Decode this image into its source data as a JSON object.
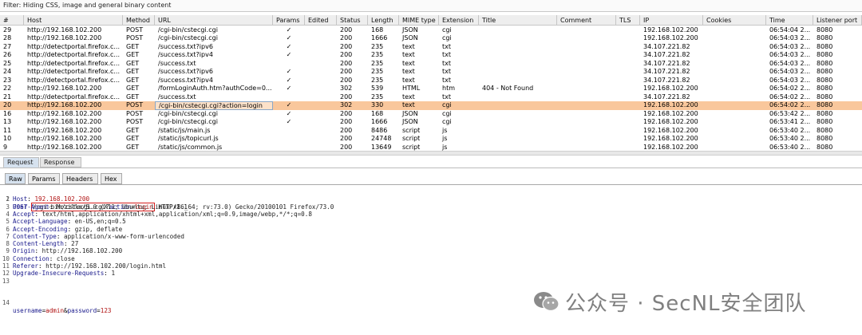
{
  "filter": {
    "text": "Filter: Hiding CSS, image and general binary content"
  },
  "table": {
    "headers": [
      "#",
      "Host",
      "Method",
      "URL",
      "Params",
      "Edited",
      "Status",
      "Length",
      "MIME type",
      "Extension",
      "Title",
      "Comment",
      "TLS",
      "IP",
      "Cookies",
      "Time",
      "Listener port"
    ],
    "rows": [
      [
        "29",
        "http://192.168.102.200",
        "POST",
        "/cgi-bin/cstecgi.cgi",
        "✓",
        "",
        "200",
        "168",
        "JSON",
        "cgi",
        "",
        "",
        "",
        "192.168.102.200",
        "",
        "06:54:04 2...",
        "8080"
      ],
      [
        "28",
        "http://192.168.102.200",
        "POST",
        "/cgi-bin/cstecgi.cgi",
        "✓",
        "",
        "200",
        "1666",
        "JSON",
        "cgi",
        "",
        "",
        "",
        "192.168.102.200",
        "",
        "06:54:03 2...",
        "8080"
      ],
      [
        "27",
        "http://detectportal.firefox.c...",
        "GET",
        "/success.txt?ipv6",
        "✓",
        "",
        "200",
        "235",
        "text",
        "txt",
        "",
        "",
        "",
        "34.107.221.82",
        "",
        "06:54:03 2...",
        "8080"
      ],
      [
        "26",
        "http://detectportal.firefox.c...",
        "GET",
        "/success.txt?ipv4",
        "✓",
        "",
        "200",
        "235",
        "text",
        "txt",
        "",
        "",
        "",
        "34.107.221.82",
        "",
        "06:54:03 2...",
        "8080"
      ],
      [
        "25",
        "http://detectportal.firefox.c...",
        "GET",
        "/success.txt",
        "",
        "",
        "200",
        "235",
        "text",
        "txt",
        "",
        "",
        "",
        "34.107.221.82",
        "",
        "06:54:03 2...",
        "8080"
      ],
      [
        "24",
        "http://detectportal.firefox.c...",
        "GET",
        "/success.txt?ipv6",
        "✓",
        "",
        "200",
        "235",
        "text",
        "txt",
        "",
        "",
        "",
        "34.107.221.82",
        "",
        "06:54:03 2...",
        "8080"
      ],
      [
        "23",
        "http://detectportal.firefox.c...",
        "GET",
        "/success.txt?ipv4",
        "✓",
        "",
        "200",
        "235",
        "text",
        "txt",
        "",
        "",
        "",
        "34.107.221.82",
        "",
        "06:54:03 2...",
        "8080"
      ],
      [
        "22",
        "http://192.168.102.200",
        "GET",
        "/formLoginAuth.htm?authCode=0...",
        "✓",
        "",
        "302",
        "539",
        "HTML",
        "htm",
        "404 - Not Found",
        "",
        "",
        "192.168.102.200",
        "",
        "06:54:02 2...",
        "8080"
      ],
      [
        "21",
        "http://detectportal.firefox.c...",
        "GET",
        "/success.txt",
        "",
        "",
        "200",
        "235",
        "text",
        "txt",
        "",
        "",
        "",
        "34.107.221.82",
        "",
        "06:54:02 2...",
        "8080"
      ],
      [
        "20",
        "http://192.168.102.200",
        "POST",
        "/cgi-bin/cstecgi.cgi?action=login",
        "✓",
        "",
        "302",
        "330",
        "text",
        "cgi",
        "",
        "",
        "",
        "192.168.102.200",
        "",
        "06:54:02 2...",
        "8080"
      ],
      [
        "16",
        "http://192.168.102.200",
        "POST",
        "/cgi-bin/cstecgi.cgi",
        "✓",
        "",
        "200",
        "168",
        "JSON",
        "cgi",
        "",
        "",
        "",
        "192.168.102.200",
        "",
        "06:53:42 2...",
        "8080"
      ],
      [
        "13",
        "http://192.168.102.200",
        "POST",
        "/cgi-bin/cstecgi.cgi",
        "✓",
        "",
        "200",
        "1666",
        "JSON",
        "cgi",
        "",
        "",
        "",
        "192.168.102.200",
        "",
        "06:53:41 2...",
        "8080"
      ],
      [
        "11",
        "http://192.168.102.200",
        "GET",
        "/static/js/main.js",
        "",
        "",
        "200",
        "8486",
        "script",
        "js",
        "",
        "",
        "",
        "192.168.102.200",
        "",
        "06:53:40 2...",
        "8080"
      ],
      [
        "10",
        "http://192.168.102.200",
        "GET",
        "/static/js/topicurl.js",
        "",
        "",
        "200",
        "24748",
        "script",
        "js",
        "",
        "",
        "",
        "192.168.102.200",
        "",
        "06:53:40 2...",
        "8080"
      ],
      [
        "9",
        "http://192.168.102.200",
        "GET",
        "/static/js/common.js",
        "",
        "",
        "200",
        "13649",
        "script",
        "js",
        "",
        "",
        "",
        "192.168.102.200",
        "",
        "06:53:40 2...",
        "8080"
      ]
    ],
    "selected_row": "20"
  },
  "tabs": {
    "request": "Request",
    "response": "Response"
  },
  "subtabs": {
    "raw": "Raw",
    "params": "Params",
    "headers": "Headers",
    "hex": "Hex"
  },
  "request": {
    "line1": {
      "method": "POST ",
      "path": "/cgi-bin/cstecgi.cgi",
      "qmark": "?",
      "qkey": "action",
      "eq": "=",
      "qval": "login",
      "proto": " HTTP/1.1"
    },
    "headers": [
      {
        "n": "2",
        "name": "Host",
        "value": " 192.168.102.200"
      },
      {
        "n": "3",
        "name": "User-Agent",
        "value": " Mozilla/5.0 (X11; Ubuntu; Linux x86_64; rv:73.0) Gecko/20100101 Firefox/73.0"
      },
      {
        "n": "4",
        "name": "Accept",
        "value": " text/html,application/xhtml+xml,application/xml;q=0.9,image/webp,*/*;q=0.8"
      },
      {
        "n": "5",
        "name": "Accept-Language",
        "value": " en-US,en;q=0.5"
      },
      {
        "n": "6",
        "name": "Accept-Encoding",
        "value": " gzip, deflate"
      },
      {
        "n": "7",
        "name": "Content-Type",
        "value": " application/x-www-form-urlencoded"
      },
      {
        "n": "8",
        "name": "Content-Length",
        "value": " 27"
      },
      {
        "n": "9",
        "name": "Origin",
        "value": " http://192.168.102.200"
      },
      {
        "n": "10",
        "name": "Connection",
        "value": " close"
      },
      {
        "n": "11",
        "name": "Referer",
        "value": " http://192.168.102.200/login.html"
      },
      {
        "n": "12",
        "name": "Upgrade-Insecure-Requests",
        "value": " 1"
      }
    ],
    "body": {
      "k1": "username",
      "eq1": "=",
      "v1": "admin",
      "amp": "&",
      "k2": "password",
      "eq2": "=",
      "v2": "123"
    }
  },
  "watermark": {
    "text": "公众号 · SecNL安全团队"
  }
}
